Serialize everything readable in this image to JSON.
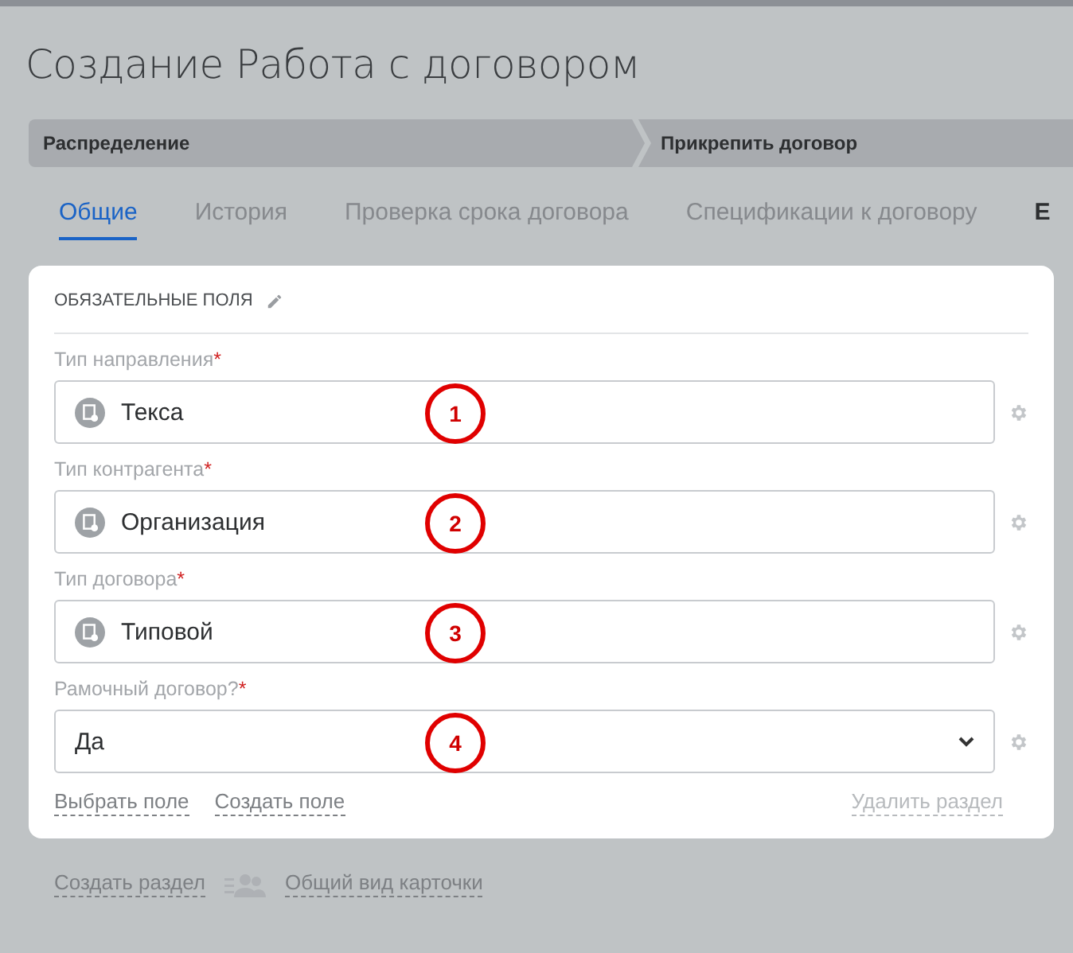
{
  "title": "Создание Работа с договором",
  "stages": [
    "Распределение",
    "Прикрепить договор"
  ],
  "tabs": [
    {
      "label": "Общие",
      "selected": true
    },
    {
      "label": "История",
      "selected": false
    },
    {
      "label": "Проверка срока договора",
      "selected": false
    },
    {
      "label": "Спецификации к договору",
      "selected": false
    },
    {
      "label": "Е",
      "selected": false
    }
  ],
  "section": {
    "title": "ОБЯЗАТЕЛЬНЫЕ ПОЛЯ",
    "fields": [
      {
        "label": "Тип направления",
        "required": "*",
        "kind": "lookup",
        "value": "Текса",
        "annotation": "1"
      },
      {
        "label": "Тип контрагента",
        "required": "*",
        "kind": "lookup",
        "value": "Организация",
        "annotation": "2"
      },
      {
        "label": "Тип договора",
        "required": "*",
        "kind": "lookup",
        "value": "Типовой",
        "annotation": "3"
      },
      {
        "label": "Рамочный договор?",
        "required": "*",
        "kind": "select",
        "value": "Да",
        "annotation": "4"
      }
    ],
    "links": [
      "Выбрать поле",
      "Создать поле"
    ],
    "delete_link": "Удалить раздел"
  },
  "bottom_links": {
    "create_section": "Создать раздел",
    "card_view": "Общий вид карточки"
  }
}
